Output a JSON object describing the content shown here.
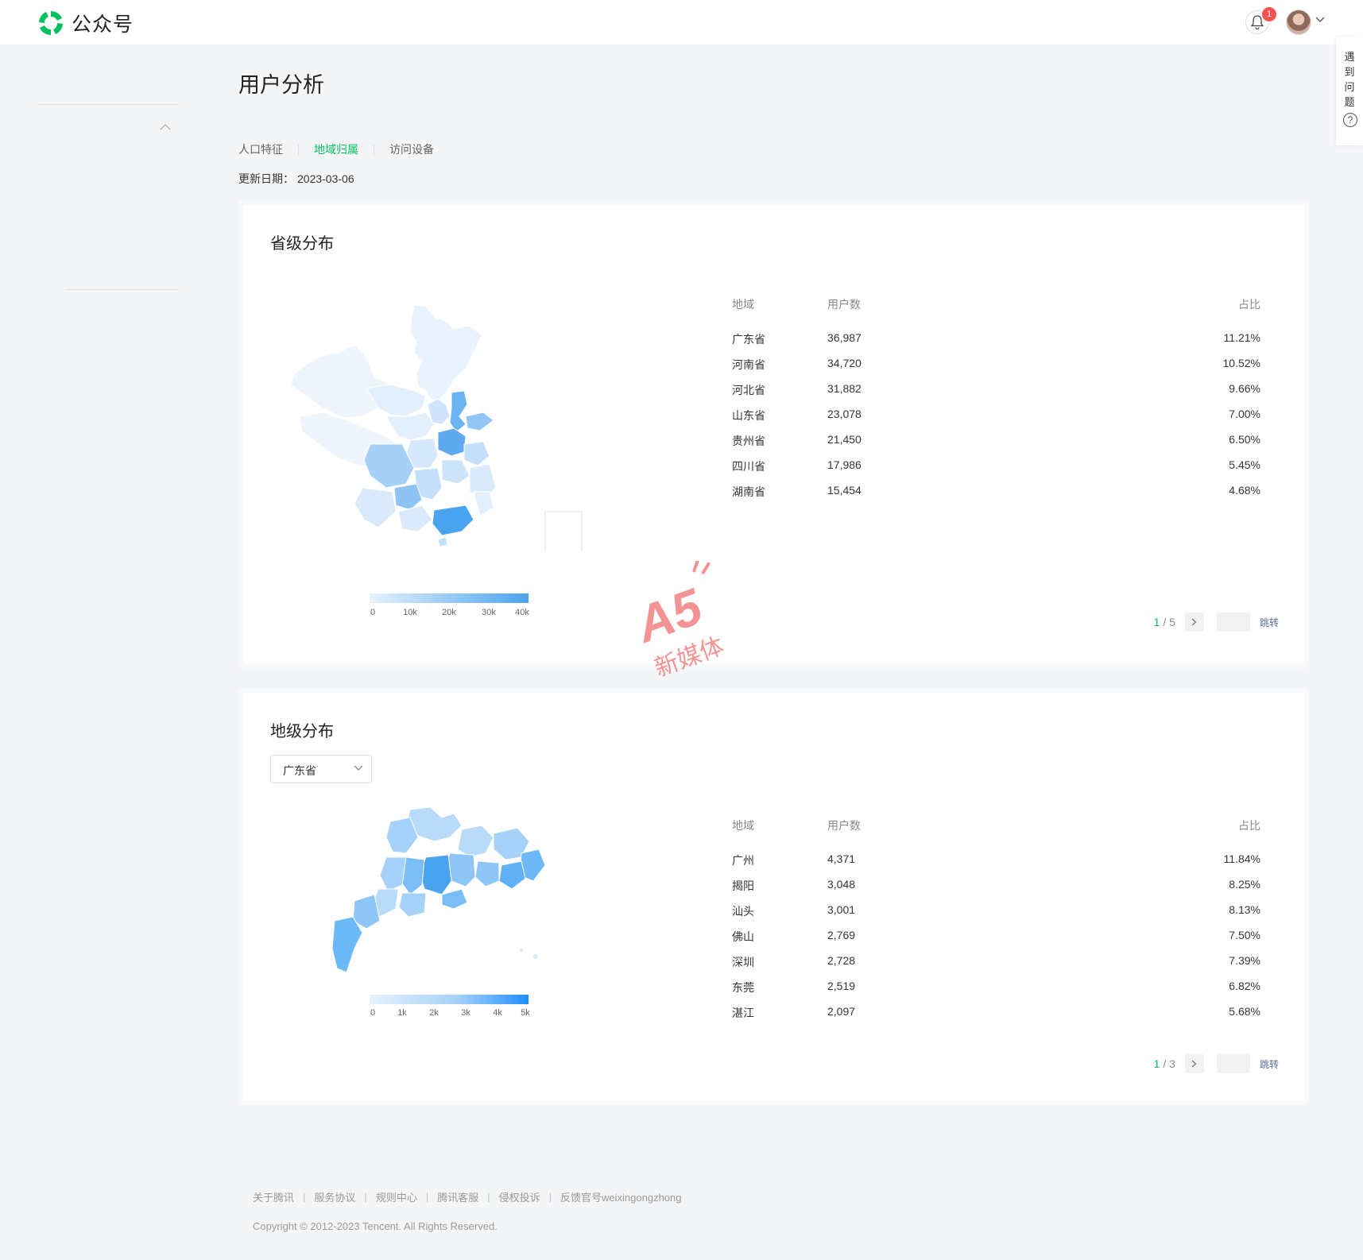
{
  "header": {
    "brand": "公众号",
    "notification_count": "1"
  },
  "help_tab": {
    "label": "遇到问题",
    "icon_glyph": "?"
  },
  "page": {
    "title": "用户分析",
    "tabs": [
      {
        "label": "人口特征",
        "active": false
      },
      {
        "label": "地域归属",
        "active": true
      },
      {
        "label": "访问设备",
        "active": false
      }
    ],
    "update_label": "更新日期：",
    "update_date": "2023-03-06"
  },
  "province_section": {
    "title": "省级分布",
    "legend_ticks": [
      "0",
      "10k",
      "20k",
      "30k",
      "40k"
    ],
    "table_headers": {
      "region": "地域",
      "users": "用户数",
      "share": "占比"
    },
    "rows": [
      {
        "region": "广东省",
        "users": "36,987",
        "share": "11.21%"
      },
      {
        "region": "河南省",
        "users": "34,720",
        "share": "10.52%"
      },
      {
        "region": "河北省",
        "users": "31,882",
        "share": "9.66%"
      },
      {
        "region": "山东省",
        "users": "23,078",
        "share": "7.00%"
      },
      {
        "region": "贵州省",
        "users": "21,450",
        "share": "6.50%"
      },
      {
        "region": "四川省",
        "users": "17,986",
        "share": "5.45%"
      },
      {
        "region": "湖南省",
        "users": "15,454",
        "share": "4.68%"
      }
    ],
    "pager": {
      "current": "1",
      "total": "/ 5",
      "jump": "跳转"
    }
  },
  "city_section": {
    "title": "地级分布",
    "selected_province": "广东省",
    "legend_ticks": [
      "0",
      "1k",
      "2k",
      "3k",
      "4k",
      "5k"
    ],
    "table_headers": {
      "region": "地域",
      "users": "用户数",
      "share": "占比"
    },
    "rows": [
      {
        "region": "广州",
        "users": "4,371",
        "share": "11.84%"
      },
      {
        "region": "揭阳",
        "users": "3,048",
        "share": "8.25%"
      },
      {
        "region": "汕头",
        "users": "3,001",
        "share": "8.13%"
      },
      {
        "region": "佛山",
        "users": "2,769",
        "share": "7.50%"
      },
      {
        "region": "深圳",
        "users": "2,728",
        "share": "7.39%"
      },
      {
        "region": "东莞",
        "users": "2,519",
        "share": "6.82%"
      },
      {
        "region": "湛江",
        "users": "2,097",
        "share": "5.68%"
      }
    ],
    "pager": {
      "current": "1",
      "total": "/ 3",
      "jump": "跳转"
    }
  },
  "watermark": {
    "logo": "A5",
    "text": "新媒体"
  },
  "footer": {
    "links": [
      "关于腾讯",
      "服务协议",
      "规则中心",
      "腾讯客服",
      "侵权投诉",
      "反馈官号weixingongzhong"
    ],
    "separator": "|",
    "copyright": "Copyright © 2012-2023 Tencent. All Rights Reserved."
  },
  "colors": {
    "accent_green": "#07c160",
    "map_low": "#e6f2fd",
    "map_high": "#4aa3ee",
    "city_high": "#1e90ff",
    "link": "#576b95"
  }
}
